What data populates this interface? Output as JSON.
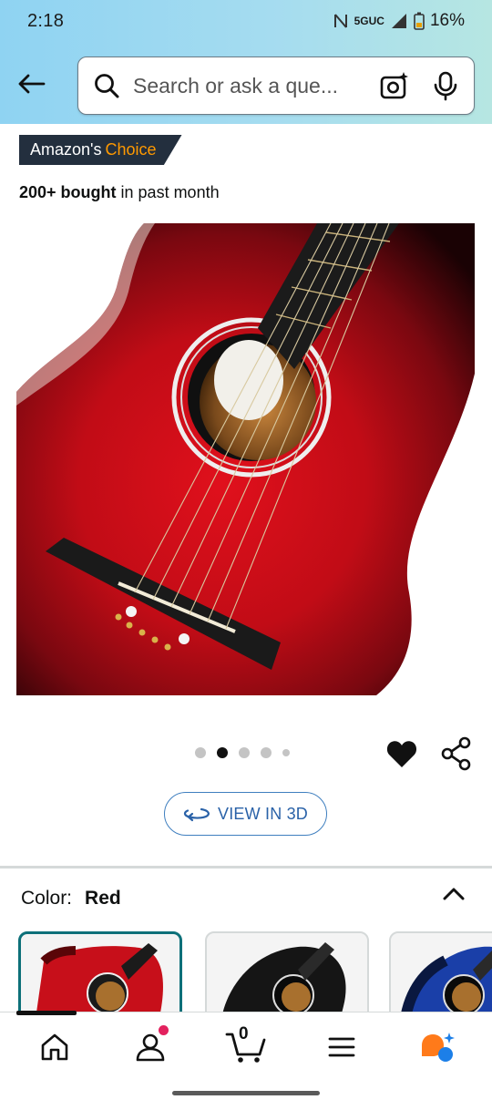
{
  "status_bar": {
    "time": "2:18",
    "network": "5GUC",
    "battery": "16%"
  },
  "header": {
    "search_placeholder": "Search or ask a que..."
  },
  "badges": {
    "amazons": "Amazon's",
    "choice": "Choice",
    "bought_strong": "200+ bought",
    "bought_rest": "in past month"
  },
  "carousel": {
    "total": 5,
    "active_index": 1
  },
  "actions": {
    "view_3d": "VIEW IN 3D"
  },
  "variation": {
    "label": "Color:",
    "value": "Red",
    "options": [
      "Red",
      "Black",
      "Blue"
    ]
  },
  "bottom_nav": {
    "cart_count": "0",
    "items": [
      "home",
      "account",
      "cart",
      "menu",
      "rufus"
    ]
  },
  "colors": {
    "accent_orange": "#ff9900",
    "badge_dark": "#232f3e",
    "link_blue": "#2a62a8",
    "selected_teal": "#0d7079",
    "notification_pink": "#e3215e"
  }
}
